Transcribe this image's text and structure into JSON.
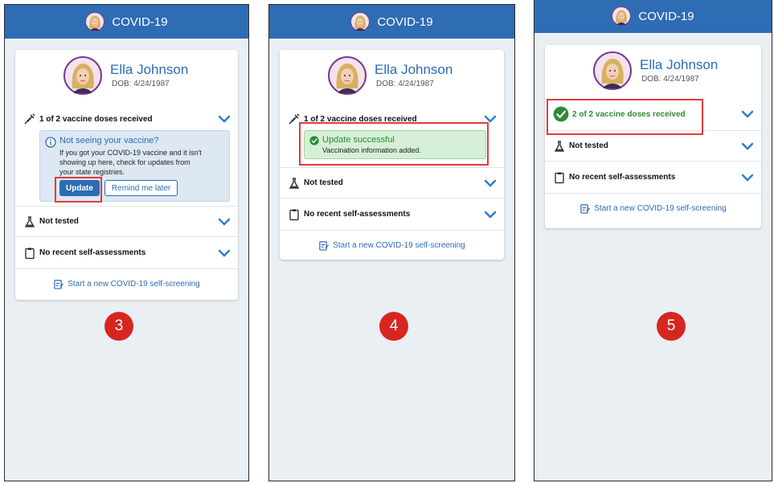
{
  "app_title": "COVID-19",
  "patient": {
    "name": "Ella Johnson",
    "dob": "DOB: 4/24/1987"
  },
  "colors": {
    "header": "#2e6cb3",
    "link": "#2b6cb5",
    "success": "#2f8a35",
    "highlight": "#e03c3c",
    "step": "#d7261f"
  },
  "panels": [
    {
      "step": "3",
      "vaccine_label": "1 of 2 vaccine doses received",
      "notice": {
        "title": "Not seeing your vaccine?",
        "body": "If you got your COVID-19 vaccine and it isn't showing up here, check for updates from your state registries.",
        "update_label": "Update",
        "remind_label": "Remind me later"
      },
      "test_label": "Not tested",
      "assess_label": "No recent self-assessments",
      "link_label": "Start a new COVID-19 self-screening"
    },
    {
      "step": "4",
      "vaccine_label": "1 of 2 vaccine doses received",
      "success": {
        "title": "Update successful",
        "body": "Vaccination information added."
      },
      "test_label": "Not tested",
      "assess_label": "No recent self-assessments",
      "link_label": "Start a new COVID-19 self-screening"
    },
    {
      "step": "5",
      "vaccine_label": "2 of 2 vaccine doses received",
      "test_label": "Not tested",
      "assess_label": "No recent self-assessments",
      "link_label": "Start a new COVID-19 self-screening"
    }
  ]
}
